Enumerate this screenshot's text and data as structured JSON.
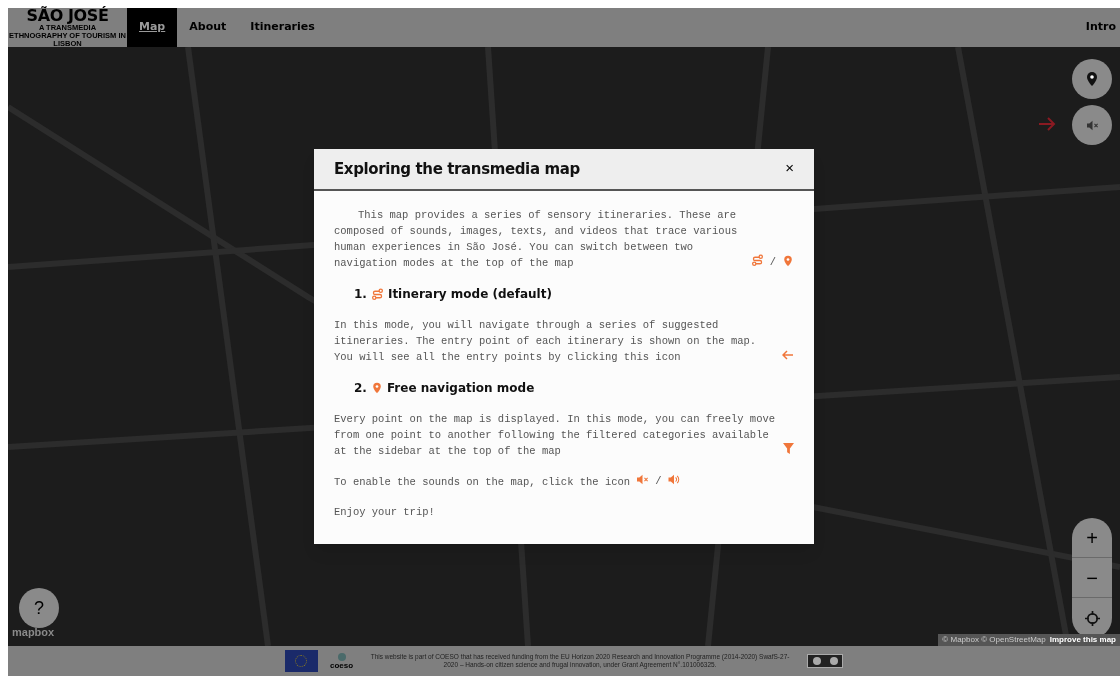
{
  "nav": {
    "logo_title": "SÃO JOSÉ",
    "logo_subtitle": "A TRANSMEDIA ETHNOGRAPHY OF TOURISM IN LISBON",
    "tabs": [
      {
        "label": "Map",
        "selected": true
      },
      {
        "label": "About",
        "selected": false
      },
      {
        "label": "Itineraries",
        "selected": false
      }
    ],
    "right_link": "Intro"
  },
  "map": {
    "help": "?",
    "attribution": "© Mapbox © OpenStreetMap",
    "improve": "Improve this map",
    "logo": "mapbox",
    "zoom_in": "+",
    "zoom_out": "−"
  },
  "modal": {
    "title": "Exploring the transmedia map",
    "close": "×",
    "blocks": [
      {
        "kind": "paragraph",
        "indent": true,
        "text": "This map provides a series of sensory itineraries. These are composed of sounds, images, texts, and videos that trace various human experiences in São José. You can switch between two navigation modes at the top of the map",
        "separator": "/"
      },
      {
        "kind": "heading",
        "number": "1.",
        "text": "Itinerary mode (default)"
      },
      {
        "kind": "paragraph",
        "indent": false,
        "text": "In this mode, you will navigate through a series of suggested itineraries. The entry point of each itinerary is shown on the map. You will see all the entry points by clicking this icon"
      },
      {
        "kind": "heading",
        "number": "2.",
        "text": "Free navigation mode"
      },
      {
        "kind": "paragraph",
        "indent": false,
        "text": "Every point on the map is displayed. In this mode, you can freely move from one point to another following the filtered categories available at the sidebar at the top of the map"
      },
      {
        "kind": "paragraph",
        "indent": false,
        "text": "To enable the sounds on the map, click the icon",
        "separator": "/"
      },
      {
        "kind": "paragraph",
        "indent": false,
        "text": "Enjoy your trip!"
      }
    ]
  },
  "footer": {
    "org": "coeso",
    "text": "This website is part of COESO that has received funding from the EU Horizon 2020 Research and Innovation Programme (2014-2020) SwafS-27-2020 – Hands-on citizen science and frugal innovation, under Grant Agreement N°.101006325."
  }
}
